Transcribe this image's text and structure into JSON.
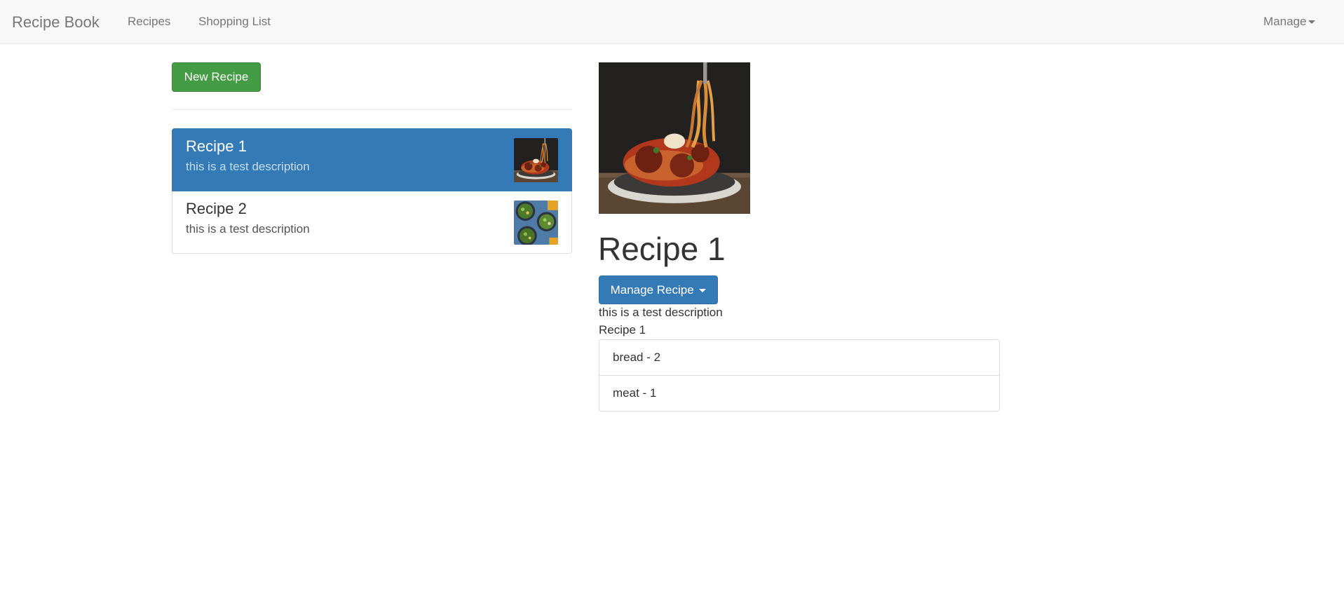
{
  "navbar": {
    "brand": "Recipe Book",
    "links": [
      "Recipes",
      "Shopping List"
    ],
    "manage_label": "Manage"
  },
  "sidebar": {
    "new_recipe_label": "New Recipe",
    "recipes": [
      {
        "name": "Recipe 1",
        "description": "this is a test description",
        "active": true,
        "thumbnail": "spaghetti-meatballs-photo"
      },
      {
        "name": "Recipe 2",
        "description": "this is a test description",
        "active": false,
        "thumbnail": "salad-bowls-photo"
      }
    ]
  },
  "detail": {
    "image": "spaghetti-meatballs-photo",
    "title": "Recipe 1",
    "manage_label": "Manage Recipe",
    "description": "this is a test description",
    "name": "Recipe 1",
    "ingredients": [
      "bread - 2",
      "meat - 1"
    ]
  },
  "colors": {
    "primary": "#337ab7",
    "success": "#449d44",
    "navbar_bg": "#f8f8f8"
  }
}
